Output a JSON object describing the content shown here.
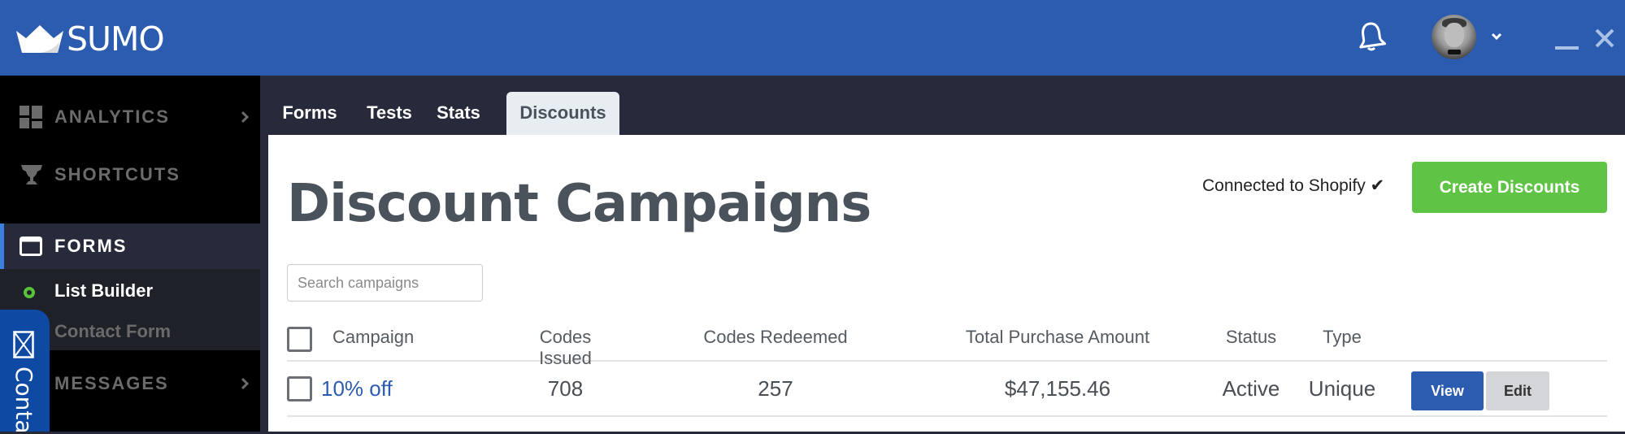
{
  "app": {
    "brand": "SUMO",
    "colors": {
      "header": "#2c5cb0",
      "accent_green": "#5fc445",
      "link_blue": "#2c5cb0"
    }
  },
  "header": {
    "icons": [
      "crown-logo-icon",
      "bell-icon",
      "user-avatar",
      "chevron-down-icon",
      "minimize-icon",
      "close-icon"
    ]
  },
  "sidebar": {
    "items": [
      {
        "label": "ANALYTICS",
        "icon": "dashboard-grid-icon",
        "has_arrow": true
      },
      {
        "label": "SHORTCUTS",
        "icon": "trophy-icon",
        "has_arrow": false
      },
      {
        "label": "FORMS",
        "icon": "window-icon",
        "active": true
      },
      {
        "label": "MESSAGES",
        "icon": "none",
        "has_arrow": true
      }
    ],
    "sub_items": [
      {
        "label": "List Builder",
        "active": true
      },
      {
        "label": "Contact Form",
        "active": false
      }
    ]
  },
  "contact_widget": {
    "label": "Conta",
    "icon": "envelope-icon"
  },
  "tabs": [
    {
      "label": "Forms",
      "active": false
    },
    {
      "label": "Tests",
      "active": false
    },
    {
      "label": "Stats",
      "active": false
    },
    {
      "label": "Discounts",
      "active": true
    }
  ],
  "main": {
    "title": "Discount Campaigns",
    "shopify_status": "Connected to Shopify ✔",
    "create_button": "Create Discounts",
    "search": {
      "placeholder": "Search campaigns",
      "value": ""
    },
    "table": {
      "columns": [
        "Campaign",
        "Codes Issued",
        "Codes Redeemed",
        "Total Purchase Amount",
        "Status",
        "Type"
      ],
      "rows": [
        {
          "campaign": "10% off",
          "codes_issued": "708",
          "codes_redeemed": "257",
          "total_purchase_amount": "$47,155.46",
          "status": "Active",
          "type": "Unique",
          "actions": [
            "View",
            "Edit"
          ]
        }
      ]
    }
  }
}
